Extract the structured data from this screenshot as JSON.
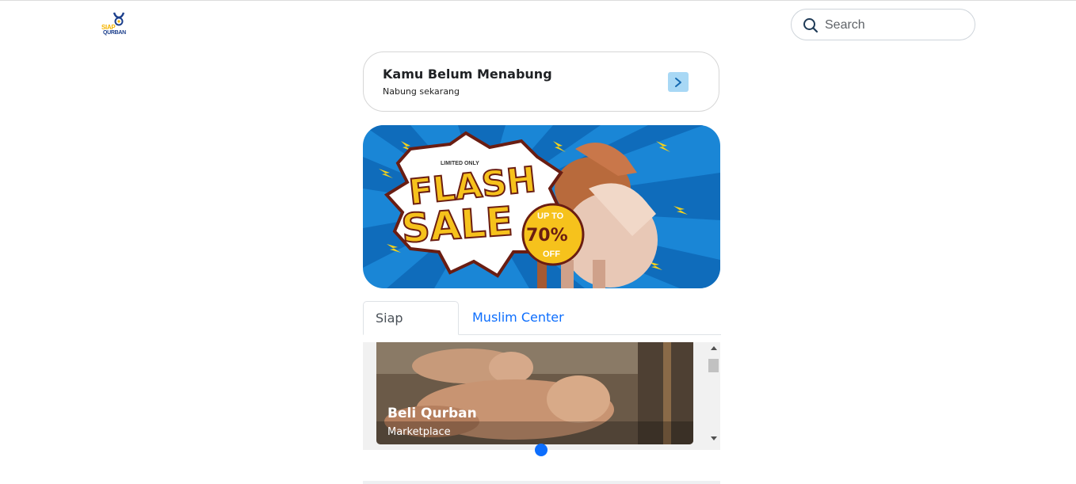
{
  "header": {
    "logo": {
      "line1": "SIAP",
      "line2": "QURBAN"
    },
    "search": {
      "placeholder": "Search",
      "icon": "search-icon"
    }
  },
  "savings_card": {
    "title": "Kamu Belum Menabung",
    "subtitle": "Nabung sekarang",
    "action_icon": "chevron-right-icon"
  },
  "banner": {
    "limited": "LIMITED ONLY",
    "flash": "FLASH",
    "sale": "SALE",
    "up_to": "UP TO",
    "discount": "70%",
    "off": "OFF"
  },
  "tabs": [
    {
      "label": "Siap Qurban",
      "active": true
    },
    {
      "label": "Muslim Center",
      "active": false
    }
  ],
  "product_card": {
    "title": "Beli Qurban",
    "subtitle": "Marketplace"
  },
  "colors": {
    "primary": "#0d6efd",
    "banner_blue": "#1a86d6",
    "sale_yellow": "#f6c21c"
  }
}
